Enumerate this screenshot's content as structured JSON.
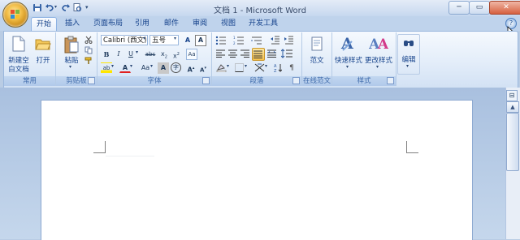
{
  "titlebar": {
    "title": "文档 1 - Microsoft Word",
    "minimize_label": "─",
    "maximize_label": "▭",
    "close_label": "✕"
  },
  "tabs": [
    {
      "label": "开始"
    },
    {
      "label": "插入"
    },
    {
      "label": "页面布局"
    },
    {
      "label": "引用"
    },
    {
      "label": "邮件"
    },
    {
      "label": "审阅"
    },
    {
      "label": "视图"
    },
    {
      "label": "开发工具"
    }
  ],
  "ribbon": {
    "new_doc": {
      "label_line1": "新建空",
      "label_line2": "白文档"
    },
    "open": {
      "label": "打开"
    },
    "paste": {
      "label": "粘贴"
    },
    "font_name": "Calibri (西文)",
    "font_size": "五号",
    "change_case_glyph": "Aa",
    "style_gallery": {
      "label": "范文"
    },
    "quick_styles": {
      "label": "快速样式"
    },
    "change_styles": {
      "label": "更改样式"
    },
    "editing": {
      "label": "编辑"
    },
    "groups": {
      "common": "常用",
      "clipboard": "剪贴板",
      "font": "字体",
      "paragraph": "段落",
      "online": "在线范文",
      "styles": "样式"
    }
  },
  "colors": {
    "ribbon_top": "#f5f9fe",
    "ribbon_bottom": "#d2e1f4",
    "group_label_text": "#3e6aaa",
    "doc_background": "#b9cce4",
    "accent_red": "#e02020",
    "highlight_yellow": "#ffe600"
  }
}
